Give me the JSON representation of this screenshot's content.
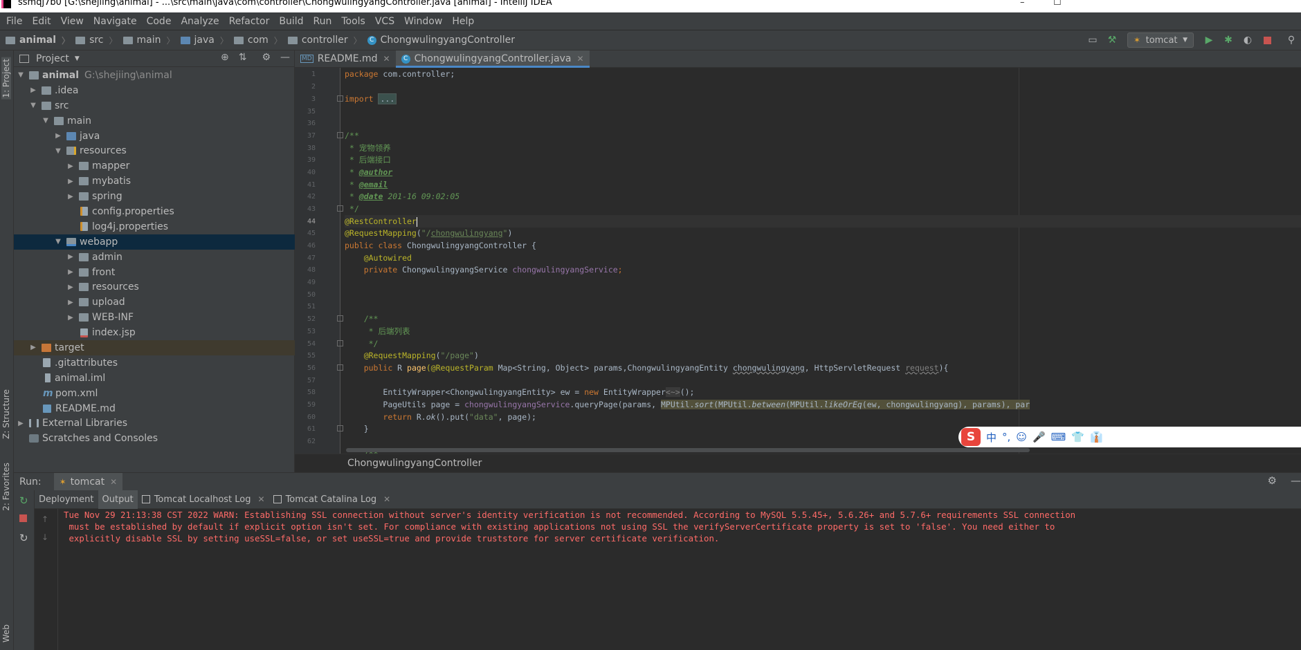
{
  "window": {
    "title": "ssmqj7b0 [G:\\shejiing\\animal] - ...\\src\\main\\java\\com\\controller\\ChongwulingyangController.java [animal] - IntelliJ IDEA",
    "minimize_glyph": "–",
    "maximize_glyph": "☐"
  },
  "menu": [
    "File",
    "Edit",
    "View",
    "Navigate",
    "Code",
    "Analyze",
    "Refactor",
    "Build",
    "Run",
    "Tools",
    "VCS",
    "Window",
    "Help"
  ],
  "breadcrumb": [
    "animal",
    "src",
    "main",
    "java",
    "com",
    "controller",
    "ChongwulingyangController"
  ],
  "toolbar": {
    "run_config": "tomcat",
    "search_glyph": "⚲"
  },
  "left_strip": {
    "project_tab": "1: Project",
    "structure_tab": "Z: Structure",
    "favorites_tab": "2: Favorites",
    "web_tab": "Web"
  },
  "project_panel": {
    "title": "Project",
    "tree": [
      {
        "name": "animal",
        "path": "G:\\shejiing\\animal",
        "icon": "folder",
        "expanded": true
      },
      {
        "name": ".idea",
        "icon": "folder"
      },
      {
        "name": "src",
        "icon": "folder",
        "expanded": true
      },
      {
        "name": "main",
        "icon": "folder",
        "expanded": true
      },
      {
        "name": "java",
        "icon": "folder-source"
      },
      {
        "name": "resources",
        "icon": "folder-resources",
        "expanded": true
      },
      {
        "name": "mapper",
        "icon": "folder"
      },
      {
        "name": "mybatis",
        "icon": "folder"
      },
      {
        "name": "spring",
        "icon": "folder"
      },
      {
        "name": "config.properties",
        "icon": "properties-file"
      },
      {
        "name": "log4j.properties",
        "icon": "properties-file"
      },
      {
        "name": "webapp",
        "icon": "folder-web",
        "expanded": true,
        "selected": true
      },
      {
        "name": "admin",
        "icon": "folder"
      },
      {
        "name": "front",
        "icon": "folder"
      },
      {
        "name": "resources",
        "icon": "folder"
      },
      {
        "name": "upload",
        "icon": "folder"
      },
      {
        "name": "WEB-INF",
        "icon": "folder"
      },
      {
        "name": "index.jsp",
        "icon": "jsp-file"
      },
      {
        "name": "target",
        "icon": "folder-excluded"
      },
      {
        "name": ".gitattributes",
        "icon": "file"
      },
      {
        "name": "animal.iml",
        "icon": "iml-file"
      },
      {
        "name": "pom.xml",
        "icon": "maven-file"
      },
      {
        "name": "README.md",
        "icon": "markdown-file"
      },
      {
        "name": "External Libraries",
        "icon": "library"
      },
      {
        "name": "Scratches and Consoles",
        "icon": "scratch"
      }
    ]
  },
  "editor": {
    "tabs": [
      {
        "label": "README.md",
        "active": false
      },
      {
        "label": "ChongwulingyangController.java",
        "active": true
      }
    ],
    "line_numbers": [
      "1",
      "2",
      "3",
      "35",
      "36",
      "37",
      "38",
      "39",
      "40",
      "41",
      "42",
      "43",
      "44",
      "45",
      "46",
      "47",
      "48",
      "49",
      "50",
      "51",
      "52",
      "53",
      "54",
      "55",
      "56",
      "57",
      "58",
      "59",
      "60",
      "61",
      "62"
    ],
    "current_line": "44",
    "code": {
      "l1_kw": "package",
      "l1_rest": " com.controller;",
      "l3_kw": "import",
      "l3_fold": "...",
      "l37": "/**",
      "l38": " * 宠物领养",
      "l39": " * 后端接口",
      "l40_star": " * ",
      "l40_tag": "@author",
      "l41_star": " * ",
      "l41_tag": "@email",
      "l42_star": " * ",
      "l42_tag": "@date",
      "l42_rest": " 201-16 09:02:05",
      "l43": " */",
      "l44": "@RestController",
      "l45_ann": "@RequestMapping",
      "l45_p1": "(",
      "l45_str1": "\"/",
      "l45_str2": "chongwulingyang",
      "l45_str3": "\"",
      "l45_p2": ")",
      "l46_kw": "public class",
      "l46_rest": " ChongwulingyangController {",
      "l47": "@Autowired",
      "l48_kw": "private",
      "l48_type": " ChongwulingyangService ",
      "l48_field": "chongwulingyangService",
      "l48_end": ";",
      "l52": "/**",
      "l53": " * 后端列表",
      "l54": " */",
      "l55_ann": "@RequestMapping",
      "l55_p1": "(",
      "l55_str": "\"/page\"",
      "l55_p2": ")",
      "l56_kw": "public",
      "l56_r": " R ",
      "l56_mth": "page",
      "l56_ann": "(@RequestParam",
      "l56_rest": " Map<String, Object> params,ChongwulingyangEntity ",
      "l56_param": "chongwulingyang",
      "l56_rest2": ", HttpServletRequest ",
      "l56_req": "request",
      "l56_end": "){",
      "l58_a": "EntityWrapper<ChongwulingyangEntity> ew = ",
      "l58_kw": "new",
      "l58_b": " EntityWrapper",
      "l58_c": "<~>",
      "l58_d": "();",
      "l59_a": "PageUtils page = ",
      "l59_field": "chongwulingyangService",
      "l59_b": ".queryPage(params, ",
      "l59_c": "MPUtil.",
      "l59_sort": "sort",
      "l59_d": "(MPUtil.",
      "l59_between": "between",
      "l59_e": "(MPUtil.",
      "l59_like": "likeOrEq",
      "l59_f": "(ew, chongwulingyang), params), par",
      "l60_kw": "return",
      "l60_a": " R.",
      "l60_ok": "ok",
      "l60_b": "().put(",
      "l60_str": "\"data\"",
      "l60_c": ", page);",
      "l61": "}",
      "l63": "/**"
    },
    "structure_breadcrumb": "ChongwulingyangController"
  },
  "ime_toolbar": {
    "logo": "S",
    "items": [
      "中",
      "°,",
      "☺",
      "🎤",
      "⌨",
      "👕",
      "👔"
    ]
  },
  "run_panel": {
    "label": "Run:",
    "config_tab": "tomcat",
    "tabs": [
      "Deployment",
      "Output",
      "Tomcat Localhost Log",
      "Tomcat Catalina Log"
    ],
    "active_tab": "Output",
    "console_lines": [
      "Tue Nov 29 21:13:38 CST 2022 WARN: Establishing SSL connection without server's identity verification is not recommended. According to MySQL 5.5.45+, 5.6.26+ and 5.7.6+ requirements SSL connection",
      " must be established by default if explicit option isn't set. For compliance with existing applications not using SSL the verifyServerCertificate property is set to 'false'. You need either to",
      " explicitly disable SSL by setting useSSL=false, or set useSSL=true and provide truststore for server certificate verification."
    ]
  }
}
